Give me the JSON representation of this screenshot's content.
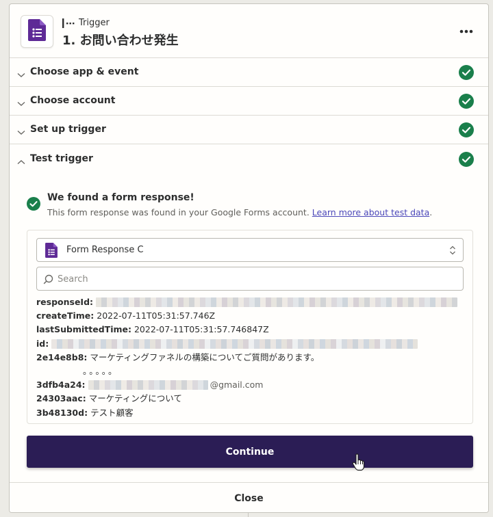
{
  "header": {
    "trigger_label": "Trigger",
    "step_title": "1. お問い合わせ発生",
    "app_icon": "google-forms-icon",
    "more_icon": "more-horizontal-icon"
  },
  "sections": [
    {
      "label": "Choose app & event",
      "status": "complete"
    },
    {
      "label": "Choose account",
      "status": "complete"
    },
    {
      "label": "Set up trigger",
      "status": "complete"
    },
    {
      "label": "Test trigger",
      "status": "complete",
      "expanded": true
    }
  ],
  "result": {
    "title": "We found a form response!",
    "subtitle": "This form response was found in your Google Forms account.",
    "link_text": "Learn more about test data",
    "after_link": "."
  },
  "record_select": {
    "value": "Form Response C"
  },
  "search": {
    "placeholder": "Search",
    "value": ""
  },
  "fields": [
    {
      "key": "responseId:",
      "value": "",
      "redacted": true
    },
    {
      "key": "createTime:",
      "value": "2022-07-11T05:31:57.746Z"
    },
    {
      "key": "lastSubmittedTime:",
      "value": "2022-07-11T05:31:57.746847Z"
    },
    {
      "key": "id:",
      "value": "",
      "redacted": true
    },
    {
      "key": "2e14e8b8:",
      "value": "マーケティングファネルの構築についてご質問があります。",
      "continuation": "。。。。。"
    },
    {
      "key": "3dfb4a24:",
      "value": "@gmail.com",
      "redacted_prefix": true
    },
    {
      "key": "24303aac:",
      "value": "マーケティングについて"
    },
    {
      "key": "3b48130d:",
      "value": "テスト顧客"
    }
  ],
  "buttons": {
    "continue": "Continue",
    "close": "Close"
  },
  "colors": {
    "success_green": "#1a7f4b",
    "primary_button": "#2b1d55",
    "forms_purple": "#5e2a96",
    "link": "#4b47b9"
  }
}
